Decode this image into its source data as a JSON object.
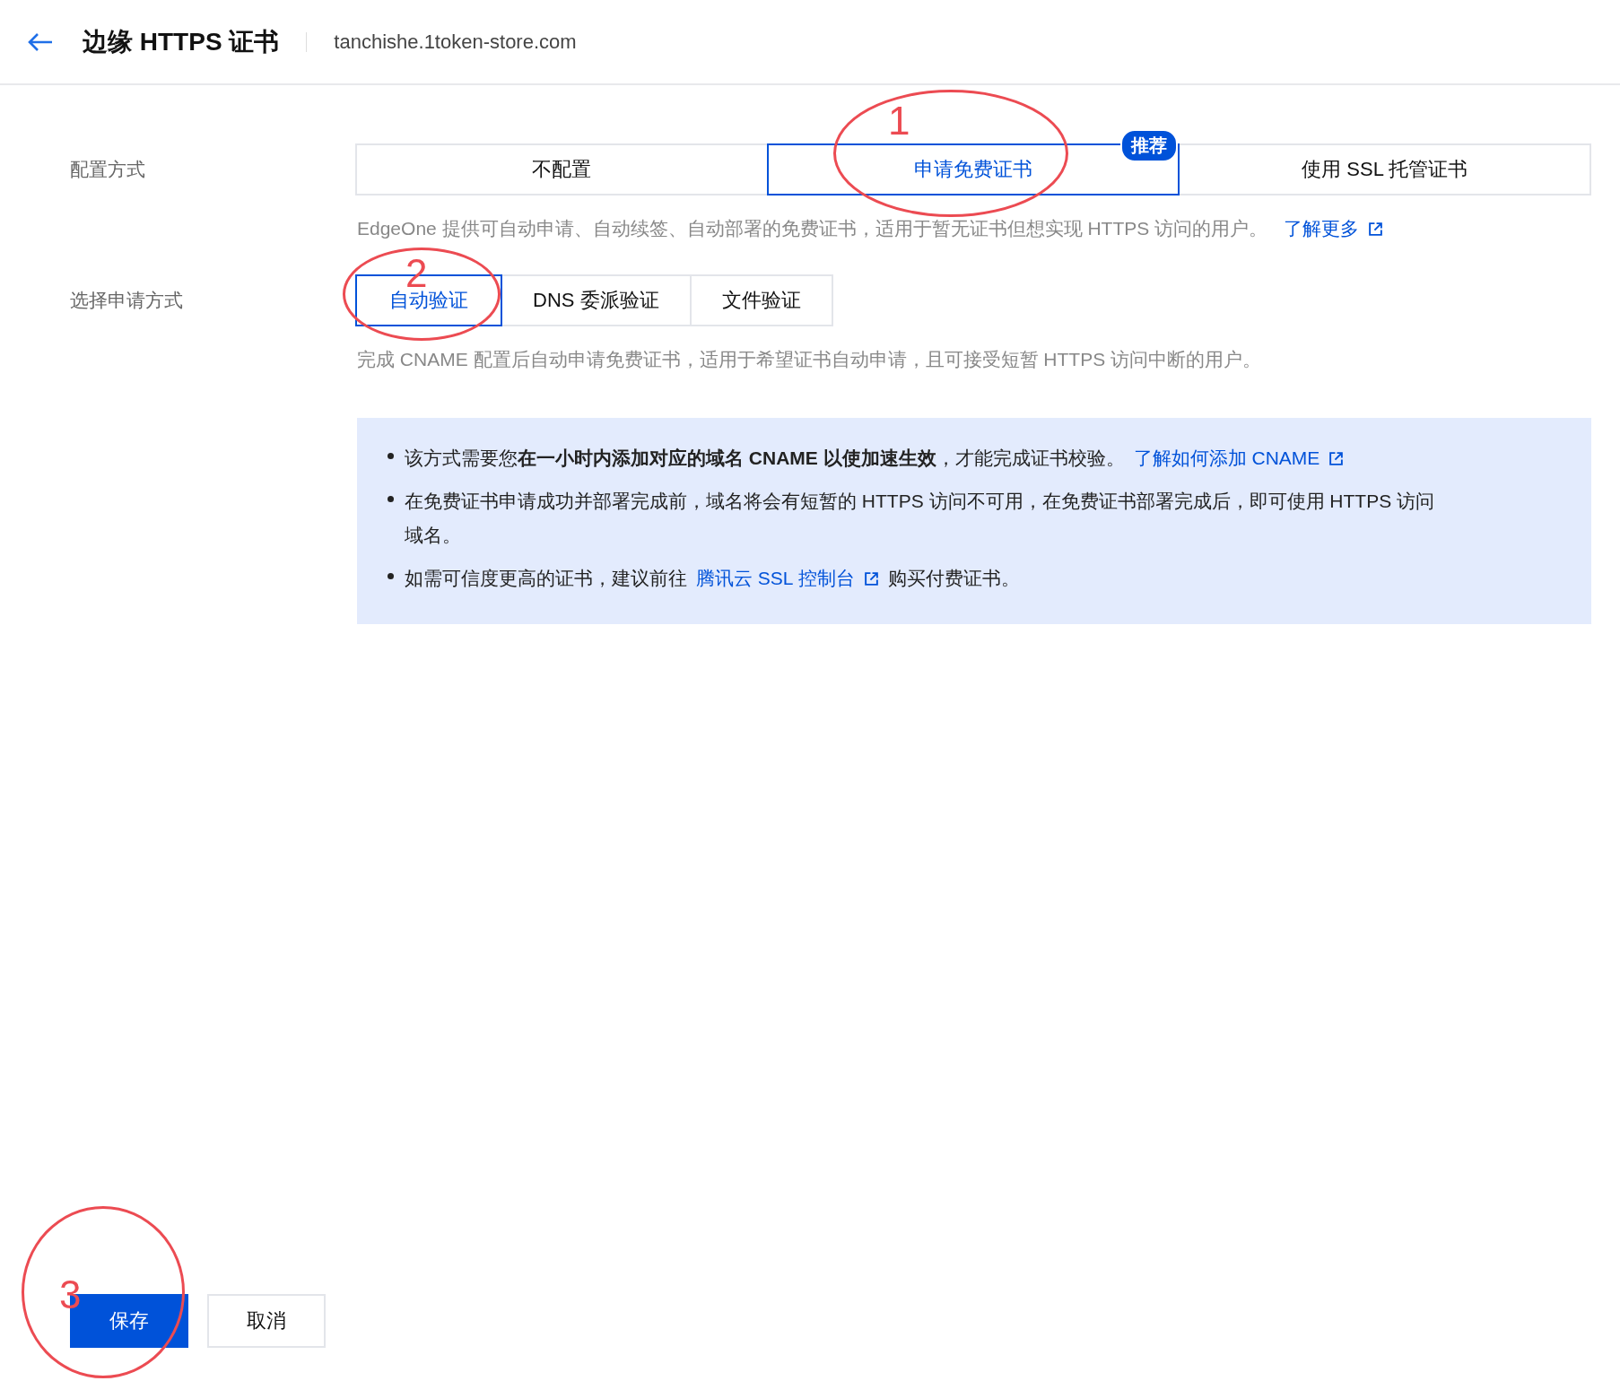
{
  "header": {
    "title": "边缘 HTTPS 证书",
    "domain": "tanchishe.1token-store.com"
  },
  "config": {
    "label": "配置方式",
    "options": [
      {
        "label": "不配置",
        "selected": false
      },
      {
        "label": "申请免费证书",
        "selected": true,
        "badge": "推荐"
      },
      {
        "label": "使用 SSL 托管证书",
        "selected": false
      }
    ],
    "description": "EdgeOne 提供可自动申请、自动续签、自动部署的免费证书，适用于暂无证书但想实现 HTTPS 访问的用户。",
    "link": "了解更多"
  },
  "method": {
    "label": "选择申请方式",
    "options": [
      {
        "label": "自动验证",
        "selected": true
      },
      {
        "label": "DNS 委派验证",
        "selected": false
      },
      {
        "label": "文件验证",
        "selected": false
      }
    ],
    "description": "完成 CNAME 配置后自动申请免费证书，适用于希望证书自动申请，且可接受短暂 HTTPS 访问中断的用户。"
  },
  "notes": [
    {
      "text": "该方式需要您**在一小时内添加对应的域名 CNAME 以使加速生效**，才能完成证书校验。",
      "link": "了解如何添加 CNAME"
    },
    {
      "text": "在免费证书申请成功并部署完成前，域名将会有短暂的 HTTPS 访问不可用，在免费证书部署完成后，即可使用 HTTPS 访问域名。"
    },
    {
      "text": "如需可信度更高的证书，建议前往",
      "link": "腾讯云 SSL 控制台",
      "after": "购买付费证书。"
    }
  ],
  "buttons": [
    {
      "label": "保存",
      "kind": "primary"
    },
    {
      "label": "取消",
      "kind": "default"
    }
  ],
  "annotations": [
    {
      "label": "1"
    },
    {
      "label": "2"
    },
    {
      "label": "3"
    }
  ]
}
